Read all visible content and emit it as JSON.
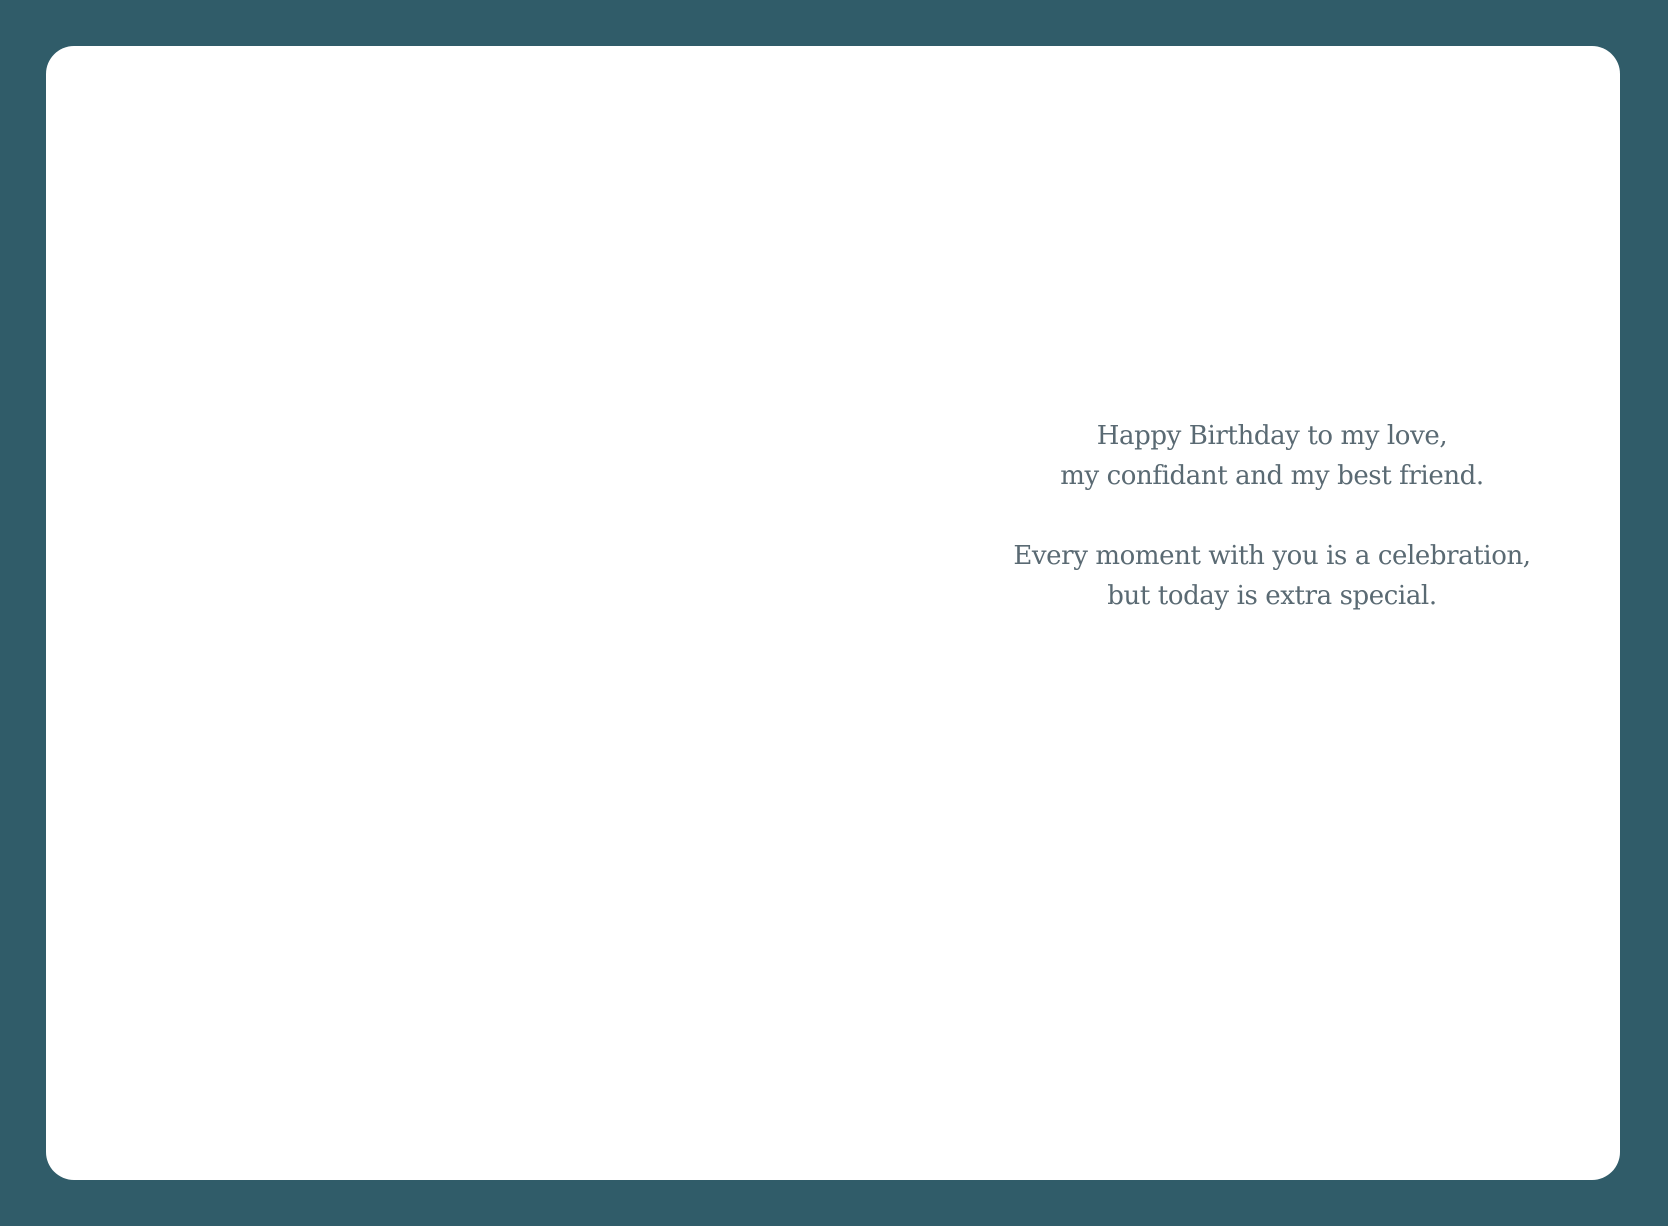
{
  "colors": {
    "background": "#305c69",
    "card": "#ffffff",
    "text": "#5a6a73"
  },
  "card": {
    "stanzas": [
      {
        "lines": [
          "Happy Birthday to my love,",
          "my confidant and my best friend."
        ]
      },
      {
        "lines": [
          "Every moment with you is a celebration,",
          "but today is extra special."
        ]
      }
    ]
  }
}
